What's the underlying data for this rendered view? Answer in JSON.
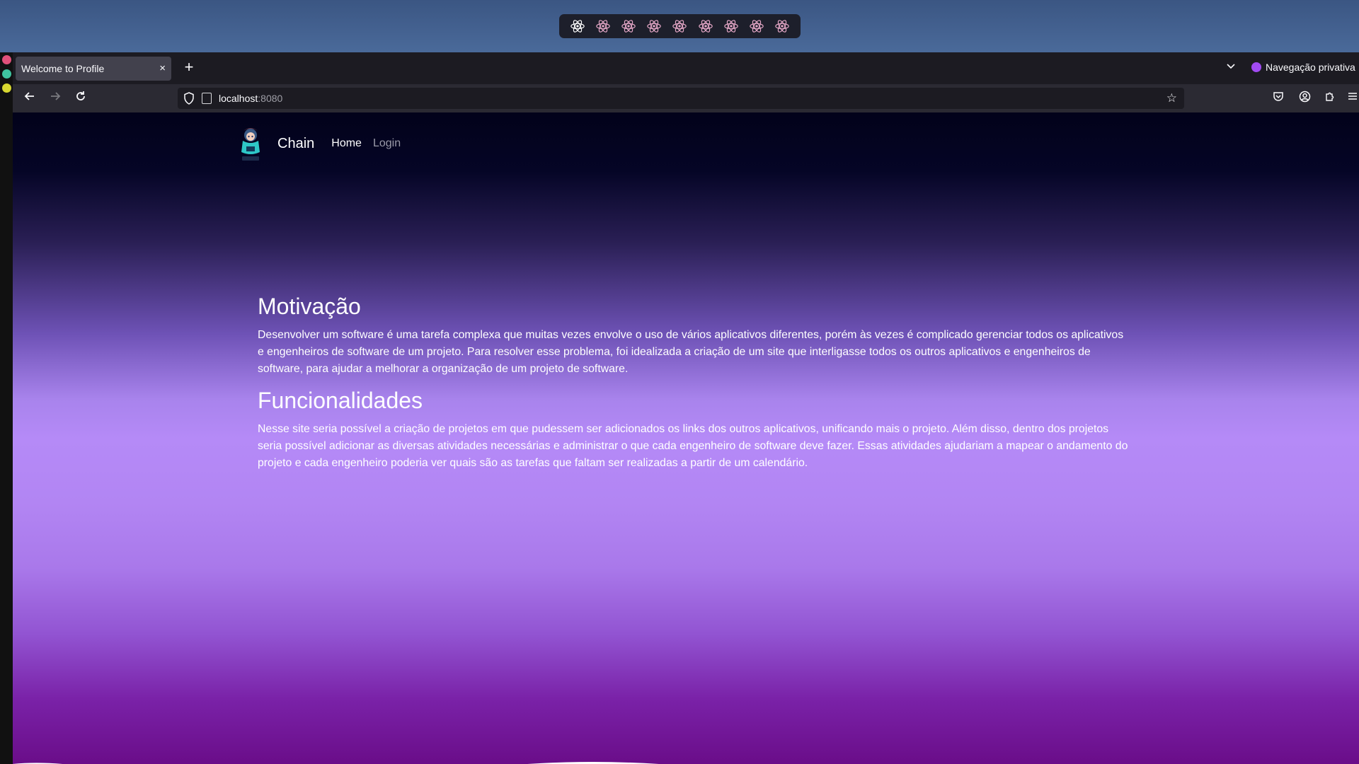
{
  "browser": {
    "tab_title": "Welcome to Profile",
    "tab_close": "×",
    "new_tab": "+",
    "private_label": "Navegação privativa",
    "url_host": "localhost",
    "url_port": ":8080"
  },
  "site": {
    "brand": "Chain",
    "nav": {
      "home": "Home",
      "login": "Login"
    }
  },
  "sections": [
    {
      "heading": "Motivação",
      "text": "Desenvolver um software é uma tarefa complexa que muitas vezes envolve o uso de vários aplicativos diferentes, porém às vezes é complicado gerenciar todos os aplicativos e engenheiros de software de um projeto. Para resolver esse problema, foi idealizada a criação de um site que interligasse todos os outros aplicativos e engenheiros de software, para ajudar a melhorar a organização de um projeto de software."
    },
    {
      "heading": "Funcionalidades",
      "text": "Nesse site seria possível a criação de projetos em que pudessem ser adicionados os links dos outros aplicativos, unificando mais o projeto. Além disso, dentro dos projetos seria possível adicionar as diversas atividades necessárias e administrar o que cada engenheiro de software deve fazer. Essas atividades ajudariam a mapear o andamento do projeto e cada engenheiro poderia ver quais são as tarefas que faltam ser realizadas a partir de um calendário."
    }
  ],
  "icons": {
    "workspace": "react-icon",
    "back": "arrow-left-icon",
    "forward": "arrow-right-icon",
    "reload": "reload-icon"
  },
  "colors": {
    "accent": "#b58af7",
    "page_top": "#02021a",
    "page_bottom": "#6a0d89",
    "private": "#a14bf2"
  }
}
